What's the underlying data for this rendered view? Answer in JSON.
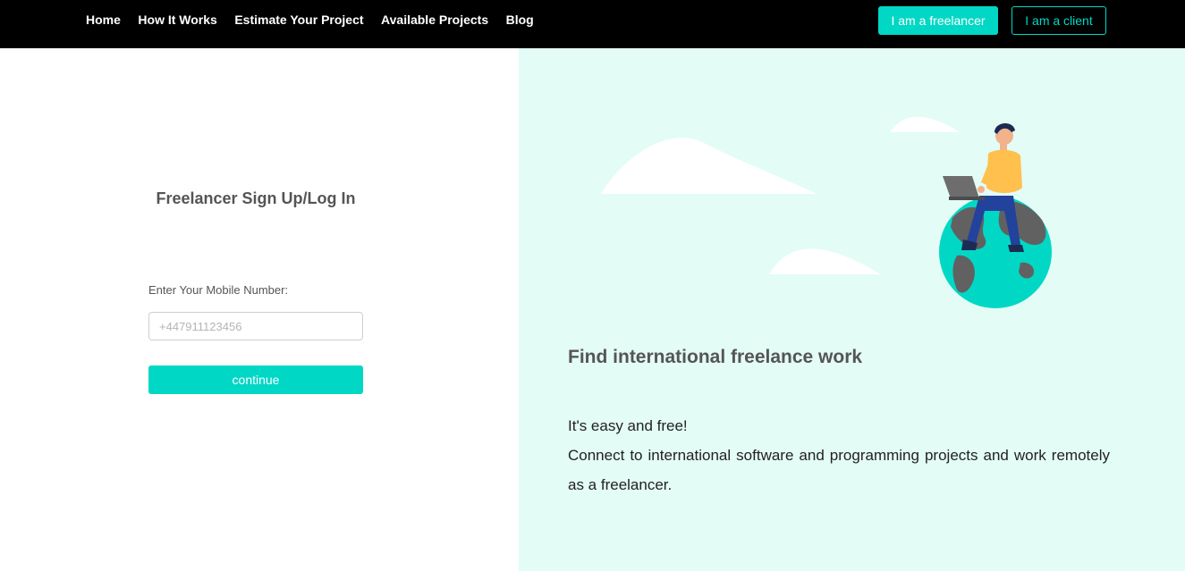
{
  "nav": {
    "links": [
      "Home",
      "How It Works",
      "Estimate Your Project",
      "Available Projects",
      "Blog"
    ],
    "freelancer_button": "I am a freelancer",
    "client_button": "I am a client"
  },
  "form": {
    "title": "Freelancer Sign Up/Log In",
    "mobile_label": "Enter Your Mobile Number:",
    "mobile_placeholder": "+447911123456",
    "mobile_value": "",
    "continue_label": "continue"
  },
  "promo": {
    "headline": "Find international freelance work",
    "line1": "It's easy and free!",
    "line2": "Connect to international software and programming projects and work remotely as a freelancer."
  },
  "icons": {
    "illustration": "freelancer-on-globe-illustration"
  },
  "colors": {
    "accent": "#00d8c5",
    "navbar": "#000000",
    "panel_bg": "#e3fcf6"
  }
}
